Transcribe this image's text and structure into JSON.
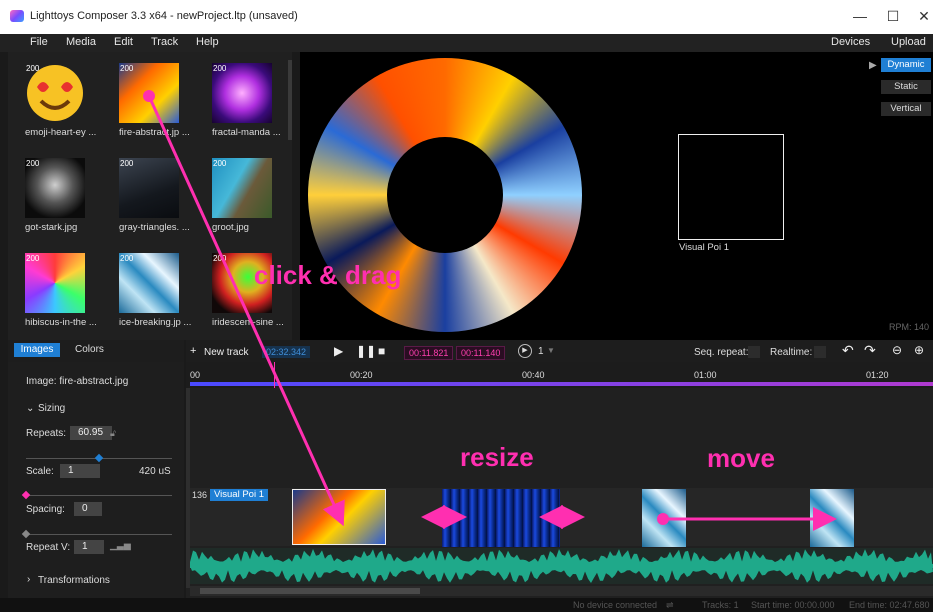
{
  "window": {
    "title": "Lighttoys Composer 3.3 x64 - newProject.ltp (unsaved)",
    "minimize": "—",
    "maximize": "☐",
    "close": "✕"
  },
  "menu": {
    "items": [
      "File",
      "Media",
      "Edit",
      "Track",
      "Help"
    ],
    "right": [
      "Devices",
      "Upload"
    ]
  },
  "library": {
    "badge": "200",
    "items": [
      {
        "label": "emoji-heart-ey ..."
      },
      {
        "label": "fire-abstract.jp ..."
      },
      {
        "label": "fractal-manda ..."
      },
      {
        "label": "got-stark.jpg"
      },
      {
        "label": "gray-triangles. ..."
      },
      {
        "label": "groot.jpg"
      },
      {
        "label": "hibiscus-in-the ..."
      },
      {
        "label": "ice-breaking.jp ..."
      },
      {
        "label": "iridescent-sine ..."
      }
    ]
  },
  "preview": {
    "modes": [
      "Dynamic",
      "Static",
      "Vertical"
    ],
    "active_mode": "Dynamic",
    "visual_poi_label": "Visual Poi 1",
    "rpm": "RPM: 140"
  },
  "tabs": {
    "images": "Images",
    "colors": "Colors"
  },
  "props": {
    "image": "Image: fire-abstract.jpg",
    "sizing": "Sizing",
    "repeats_label": "Repeats:",
    "repeats_value": "60.95",
    "scale_label": "Scale:",
    "scale_value": "1",
    "scale_unit": "420 uS",
    "spacing_label": "Spacing:",
    "spacing_value": "0",
    "repeatv_label": "Repeat V:",
    "repeatv_value": "1",
    "transformations": "Transformations"
  },
  "transport": {
    "new_track": "New track",
    "time_cursor": "02:32.342",
    "sel_start": "00:11.821",
    "sel_end": "00:11.140",
    "loop_count": "1",
    "seq_repeat": "Seq. repeat:",
    "realtime": "Realtime:"
  },
  "ruler": {
    "ticks": [
      "00",
      "00:20",
      "00:40",
      "01:00",
      "01:20"
    ]
  },
  "track": {
    "number": "136",
    "name": "Visual Poi 1"
  },
  "annotations": {
    "drag": "click & drag",
    "resize": "resize",
    "move": "move"
  },
  "status": {
    "device": "No device connected",
    "tracks": "Tracks: 1",
    "start": "Start time: 00:00.000",
    "end": "End time: 02:47.680"
  },
  "colors": {
    "accent": "#1f7fd4",
    "annotation": "#ff2fb0",
    "waveform": "#1fa98a"
  }
}
